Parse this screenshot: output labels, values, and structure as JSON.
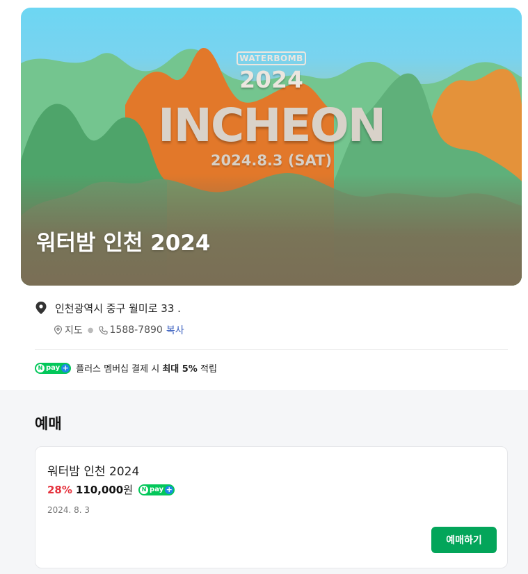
{
  "hero": {
    "poster_brand": "WATERBOMB",
    "poster_year": "2024",
    "poster_city": "INCHEON",
    "poster_date": "2024.8.3 (SAT)",
    "title": "워터밤 인천 2024"
  },
  "info": {
    "address": "인천광역시 중구 월미로 33 .",
    "map_label": "지도",
    "phone": "1588-7890",
    "copy_label": "복사"
  },
  "npay": {
    "badge_text": "pay",
    "prefix": "플러스 멤버십 결제 시",
    "highlight": "최대 5%",
    "suffix": "적립"
  },
  "booking": {
    "section_title": "예매",
    "card": {
      "title": "워터밤 인천 2024",
      "discount": "28%",
      "price": "110,000",
      "currency": "원",
      "date": "2024. 8. 3",
      "button_label": "예매하기"
    }
  },
  "colors": {
    "accent_green": "#03a55a",
    "discount_red": "#e5323d",
    "link_blue": "#3a5fbf"
  }
}
